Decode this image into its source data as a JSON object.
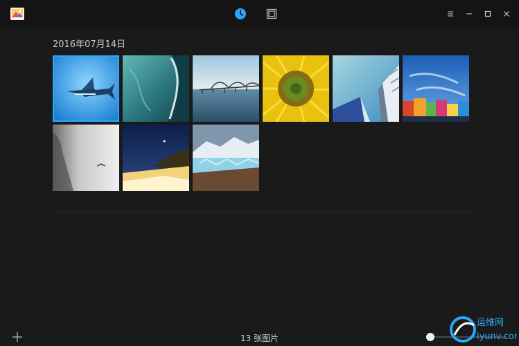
{
  "header": {
    "view_timeline": "timeline-icon",
    "view_albums": "album-icon",
    "window_controls": [
      "menu-icon",
      "minimize-icon",
      "maximize-icon",
      "close-icon"
    ]
  },
  "gallery": {
    "date": "2016年07月14日",
    "photos": [
      {
        "subject": "swordfish",
        "selected": true
      },
      {
        "subject": "ice cave"
      },
      {
        "subject": "bridge"
      },
      {
        "subject": "sunflower"
      },
      {
        "subject": "building"
      },
      {
        "subject": "colorful town"
      },
      {
        "subject": "foggy cliff"
      },
      {
        "subject": "night coast"
      },
      {
        "subject": "glacier"
      }
    ]
  },
  "footer": {
    "count": "13 张图片",
    "zoom": 0
  },
  "watermark": {
    "text_cn": "运维网",
    "text_url": "iyunv.com"
  },
  "colors": {
    "accent": "#2ca7f8",
    "background": "#1a1a1a",
    "titlebar": "#141414"
  }
}
